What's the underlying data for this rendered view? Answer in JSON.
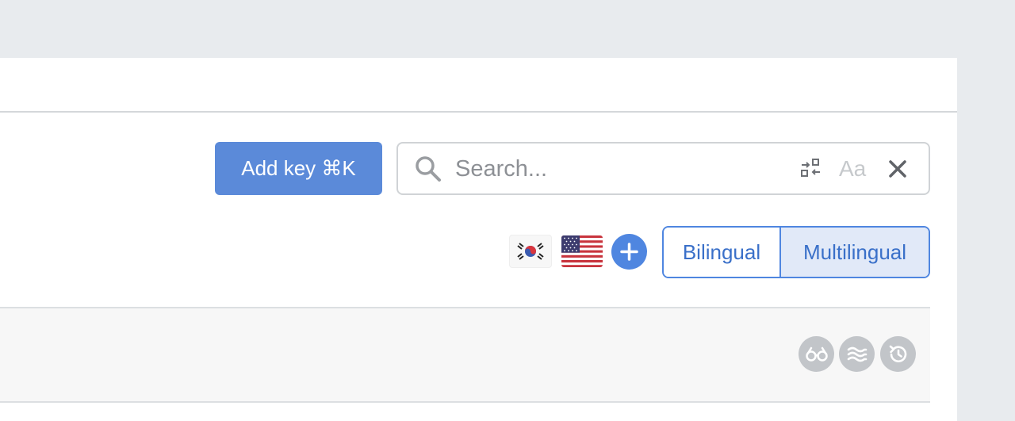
{
  "toolbar": {
    "add_key_label": "Add key ⌘K"
  },
  "search": {
    "placeholder": "Search...",
    "value": "",
    "case_toggle_label": "Aa"
  },
  "languages": {
    "flags": [
      "korea-flag-icon",
      "usa-flag-icon"
    ],
    "add_icon": "plus-icon"
  },
  "view_mode": {
    "options": [
      "Bilingual",
      "Multilingual"
    ],
    "selected": "Multilingual"
  },
  "row_actions": [
    "glasses-icon",
    "waves-icon",
    "history-icon"
  ],
  "colors": {
    "primary": "#5b8ad9",
    "accent": "#4f86e0",
    "selected_bg": "#e1e9f8",
    "muted_icon": "#c2c5c9"
  }
}
